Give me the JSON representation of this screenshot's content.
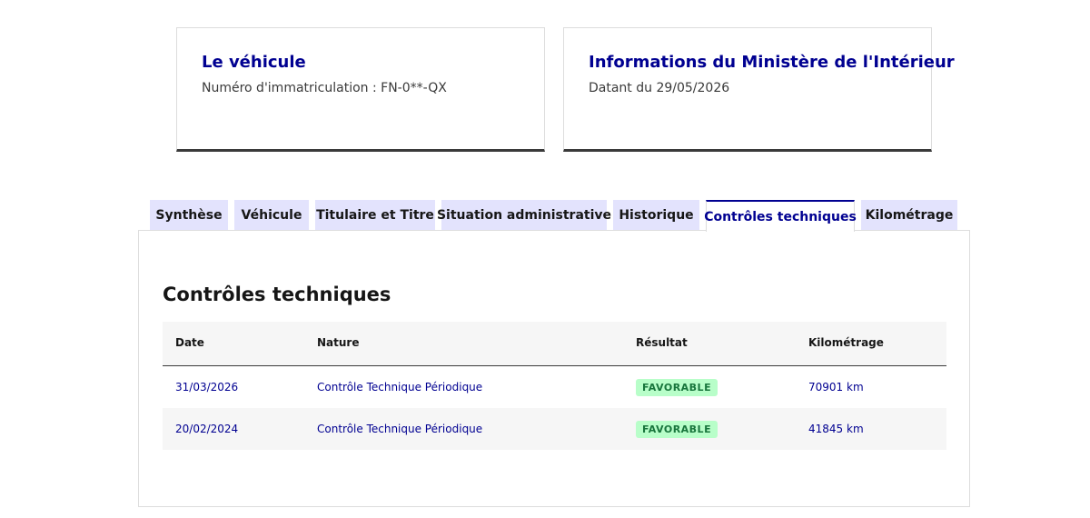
{
  "cards": {
    "vehicle": {
      "title": "Le véhicule",
      "description": "Numéro d'immatriculation : FN-0**-QX"
    },
    "ministry": {
      "title": "Informations du Ministère de l'Intérieur",
      "description": "Datant du 29/05/2026"
    }
  },
  "tabs": [
    {
      "label": "Synthèse",
      "active": false
    },
    {
      "label": "Véhicule",
      "active": false
    },
    {
      "label": "Titulaire et Titre",
      "active": false
    },
    {
      "label": "Situation administrative",
      "active": false
    },
    {
      "label": "Historique",
      "active": false
    },
    {
      "label": "Contrôles techniques",
      "active": true
    },
    {
      "label": "Kilométrage",
      "active": false
    }
  ],
  "panel": {
    "title": "Contrôles techniques",
    "table": {
      "headers": [
        "Date",
        "Nature",
        "Résultat",
        "Kilométrage"
      ],
      "rows": [
        {
          "date": "31/03/2026",
          "nature": "Contrôle Technique Périodique",
          "result": "FAVORABLE",
          "km": "70901 km"
        },
        {
          "date": "20/02/2024",
          "nature": "Contrôle Technique Périodique",
          "result": "FAVORABLE",
          "km": "41845 km"
        }
      ]
    }
  },
  "colors": {
    "primary_blue": "#000091",
    "tab_background": "#e3e3fd",
    "badge_background": "#b8fec9",
    "badge_text": "#18753c"
  }
}
